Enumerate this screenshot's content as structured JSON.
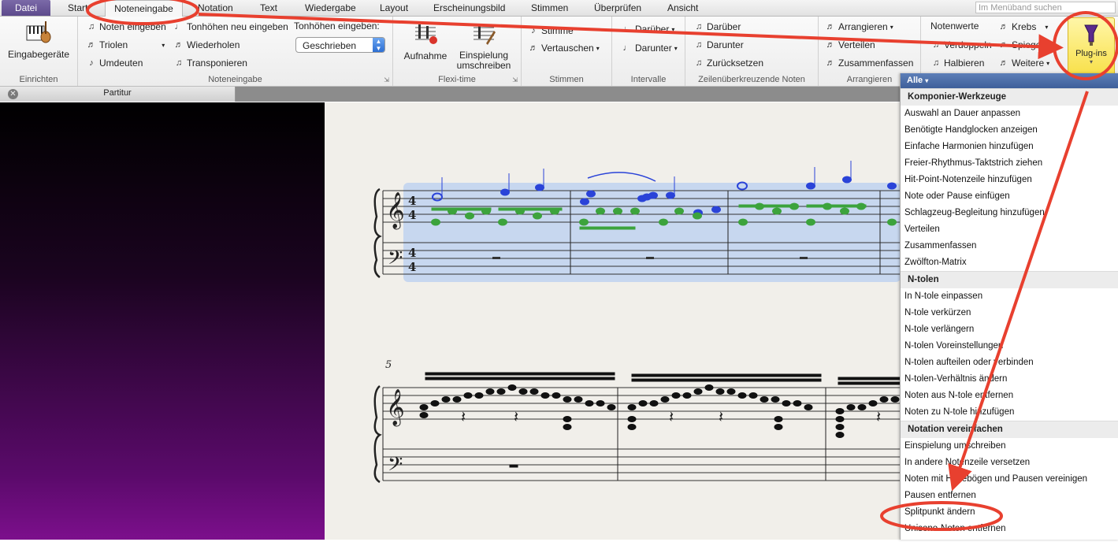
{
  "tabs": {
    "file": "Datei",
    "items": [
      "Start",
      "Noteneingabe",
      "Notation",
      "Text",
      "Wiedergabe",
      "Layout",
      "Erscheinungsbild",
      "Stimmen",
      "Überprüfen",
      "Ansicht"
    ],
    "active": "Noteneingabe",
    "search_placeholder": "Im Menüband suchen"
  },
  "ribbon": {
    "einrichten": {
      "label": "Einrichten",
      "input_devices": "Eingabegeräte"
    },
    "noteneingabe": {
      "label": "Noteneingabe",
      "enter_notes": "Noten eingeben",
      "tuplets": "Triolen",
      "reinterpret": "Umdeuten",
      "reenter_pitches": "Tonhöhen neu eingeben",
      "repeat": "Wiederholen",
      "transpose": "Transponieren",
      "input_pitches_label": "Tonhöhen eingeben:",
      "input_pitches_value": "Geschrieben"
    },
    "flexitime": {
      "label": "Flexi-time",
      "record": "Aufnahme",
      "renotate": "Einspielung umschreiben"
    },
    "stimmen": {
      "label": "Stimmen",
      "voice": "Stimme",
      "swap": "Vertauschen"
    },
    "intervalle": {
      "label": "Intervalle",
      "above": "Darüber",
      "below": "Darunter"
    },
    "crossstaff": {
      "label": "Zeilenüberkreuzende Noten",
      "above": "Darüber",
      "below": "Darunter",
      "reset": "Zurücksetzen"
    },
    "arrangieren": {
      "label": "Arrangieren",
      "arrange": "Arrangieren",
      "explode": "Verteilen",
      "reduce": "Zusammenfassen"
    },
    "notewerte": {
      "label": "Notenwerte",
      "double": "Verdoppeln",
      "halve": "Halbieren"
    },
    "weitere": {
      "retrograde": "Krebs",
      "invert": "Spiegeln",
      "more": "Weitere"
    },
    "plugins": "Plug-ins"
  },
  "doc_tab": {
    "label": "Partitur"
  },
  "score": {
    "measure_number": "5"
  },
  "menu": {
    "filter": "Alle",
    "sections": [
      {
        "title": "Komponier-Werkzeuge",
        "items": [
          "Auswahl an Dauer anpassen",
          "Benötigte Handglocken anzeigen",
          "Einfache Harmonien hinzufügen",
          "Freier-Rhythmus-Taktstrich ziehen",
          "Hit-Point-Notenzeile hinzufügen",
          "Note oder Pause einfügen",
          "Schlagzeug-Begleitung hinzufügen",
          "Verteilen",
          "Zusammenfassen",
          "Zwölfton-Matrix"
        ]
      },
      {
        "title": "N-tolen",
        "items": [
          "In N-tole einpassen",
          "N-tole verkürzen",
          "N-tole verlängern",
          "N-tolen Voreinstellungen",
          "N-tolen aufteilen oder verbinden",
          "N-tolen-Verhältnis ändern",
          "Noten aus N-tole entfernen",
          "Noten zu N-tole hinzufügen"
        ]
      },
      {
        "title": "Notation vereinfachen",
        "items": [
          "Einspielung umschreiben",
          "In andere Notenzeile versetzen",
          "Noten mit Haltebögen und Pausen vereinigen",
          "Pausen entfernen",
          "Splitpunkt ändern",
          "Unisono-Noten entfernen"
        ]
      }
    ]
  },
  "colors": {
    "annotation": "#e8402f",
    "selection": "#b8cff0",
    "voice1": "#2a43d8",
    "voice2": "#3ca33c"
  }
}
